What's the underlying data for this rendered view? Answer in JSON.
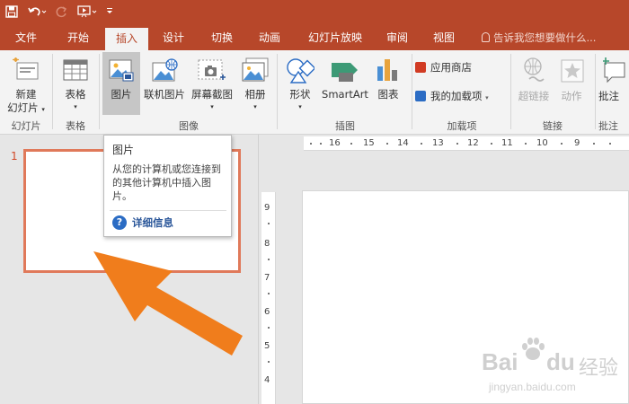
{
  "qat": {
    "save_icon": "save-icon",
    "undo_icon": "undo-icon",
    "redo_icon": "redo-icon",
    "present_icon": "present-from-start-icon",
    "customize_icon": "customize-qat-icon"
  },
  "tabs": [
    {
      "label": "文件"
    },
    {
      "label": "开始"
    },
    {
      "label": "插入"
    },
    {
      "label": "设计"
    },
    {
      "label": "切换"
    },
    {
      "label": "动画"
    },
    {
      "label": "幻灯片放映"
    },
    {
      "label": "审阅"
    },
    {
      "label": "视图"
    }
  ],
  "tell_me": "告诉我您想要做什么...",
  "ribbon": {
    "new_slide_line1": "新建",
    "new_slide_line2": "幻灯片",
    "table": "表格",
    "picture": "图片",
    "online_picture": "联机图片",
    "screenshot": "屏幕截图",
    "album": "相册",
    "shapes": "形状",
    "smartart": "SmartArt",
    "chart": "图表",
    "app_store": "应用商店",
    "my_addins": "我的加载项",
    "hyperlink": "超链接",
    "action": "动作",
    "comment": "批注",
    "groups": {
      "slides": "幻灯片",
      "tables": "表格",
      "images": "图像",
      "illustrations": "插图",
      "addins": "加载项",
      "links": "链接",
      "comments": "批注"
    }
  },
  "tooltip": {
    "title": "图片",
    "desc": "从您的计算机或您连接到的其他计算机中插入图片。",
    "more_info": "详细信息"
  },
  "slide_number": "1",
  "hruler_labels": [
    "16",
    "15",
    "14",
    "13",
    "12",
    "11",
    "10",
    "9"
  ],
  "vruler_labels": [
    "9",
    "8",
    "7",
    "6",
    "5",
    "4"
  ],
  "watermark": {
    "brand": "Bai",
    "brand2": "du",
    "cn": "经验",
    "url": "jingyan.baidu.com"
  },
  "colors": {
    "accent": "#b7472a",
    "arrow": "#f07d1c",
    "selection": "#e0795a",
    "link": "#2b579a"
  }
}
